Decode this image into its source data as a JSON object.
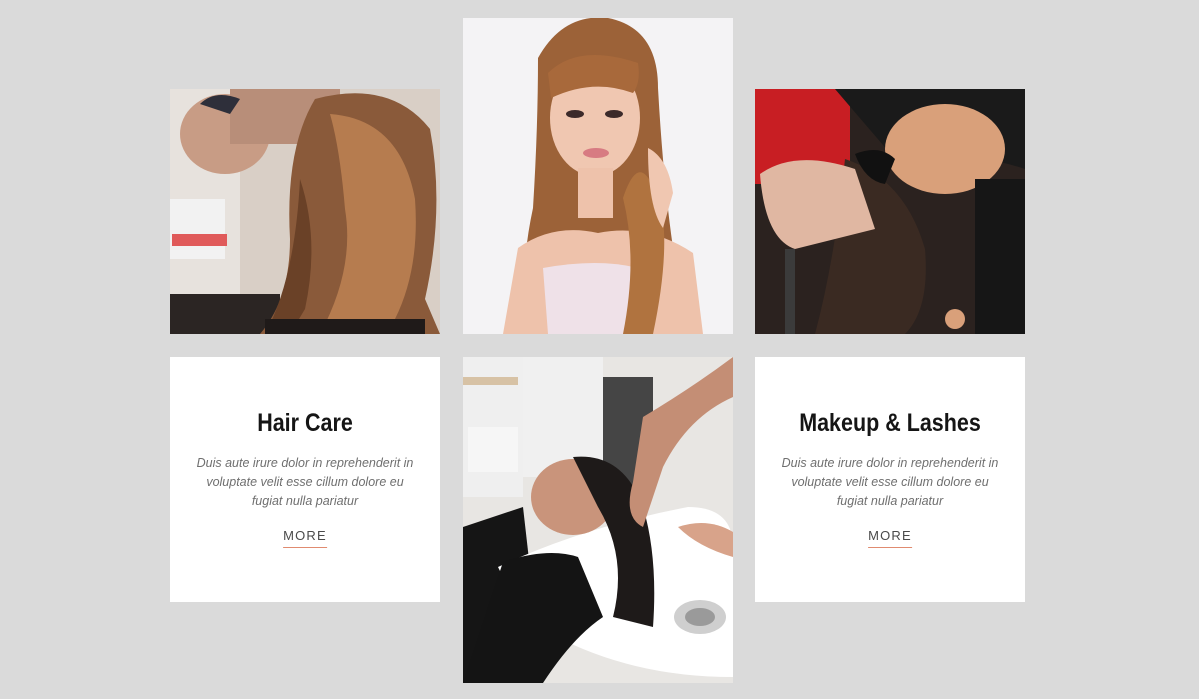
{
  "cards": [
    {
      "title": "Hair Care",
      "text": "Duis aute irure dolor in reprehenderit in voluptate velit esse cillum dolore eu fugiat nulla pariatur",
      "more_label": "MORE"
    },
    {
      "title": "Makeup & Lashes",
      "text": "Duis aute irure dolor in reprehenderit in voluptate velit esse cillum dolore eu fugiat nulla pariatur",
      "more_label": "MORE"
    }
  ],
  "colors": {
    "page_background": "#dadada",
    "card_background": "#ffffff",
    "more_underline": "#e08b70",
    "title_text": "#151515",
    "body_text": "#6f6f6f"
  }
}
